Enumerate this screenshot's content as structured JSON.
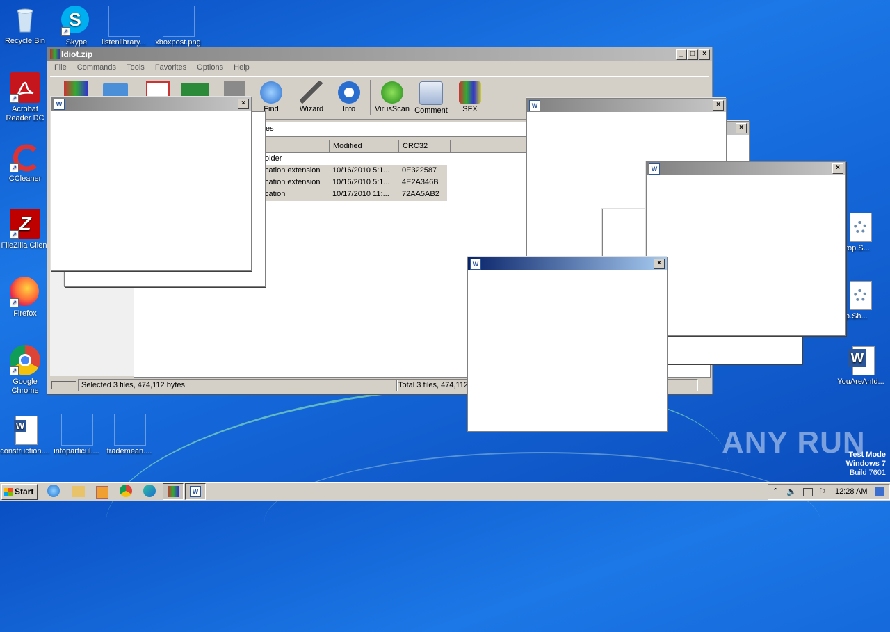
{
  "desktop": {
    "icons_left": [
      {
        "label": "Recycle Bin"
      },
      {
        "label": "Acrobat Reader DC"
      },
      {
        "label": "CCleaner"
      },
      {
        "label": "FileZilla Client"
      },
      {
        "label": "Firefox"
      },
      {
        "label": "Google Chrome"
      },
      {
        "label": "construction...."
      }
    ],
    "icons_top": [
      {
        "label": "Skype"
      },
      {
        "label": "listenlibrary..."
      },
      {
        "label": "xboxpost.png"
      }
    ],
    "icons_bottom": [
      {
        "label": "intoparticul...."
      },
      {
        "label": "trademean...."
      }
    ],
    "icons_right": [
      {
        "label": "nterop.S..."
      },
      {
        "label": "erop.Sh..."
      },
      {
        "label": "YouAreAnId..."
      }
    ],
    "watermark": {
      "brand": "ANY RUN",
      "test_mode": "Test Mode",
      "os": "Windows 7",
      "build": "Build 7601"
    }
  },
  "winrar": {
    "title": "Idiot.zip",
    "menu": [
      "File",
      "Commands",
      "Tools",
      "Favorites",
      "Options",
      "Help"
    ],
    "toolbar": [
      "Find",
      "Wizard",
      "Info",
      "VirusScan",
      "Comment",
      "SFX"
    ],
    "path_text": "tes",
    "columns": [
      "Modified",
      "CRC32"
    ],
    "rows": [
      {
        "type": "older",
        "modified": "",
        "crc": ""
      },
      {
        "type": "cation extension",
        "modified": "10/16/2010 5:1...",
        "crc": "0E322587"
      },
      {
        "type": "cation extension",
        "modified": "10/16/2010 5:1...",
        "crc": "4E2A346B"
      },
      {
        "type": "cation",
        "modified": "10/17/2010 11:...",
        "crc": "72AA5AB2"
      }
    ],
    "status_left": "Selected 3 files, 474,112 bytes",
    "status_right": "Total 3 files, 474,112"
  },
  "popups": {
    "close_glyph": "×",
    "icon_glyph": "W"
  },
  "taskbar": {
    "start_label": "Start",
    "clock": "12:28 AM"
  },
  "colors": {
    "desktop_blue": "#1466d8",
    "title_active": "#0a246a"
  }
}
